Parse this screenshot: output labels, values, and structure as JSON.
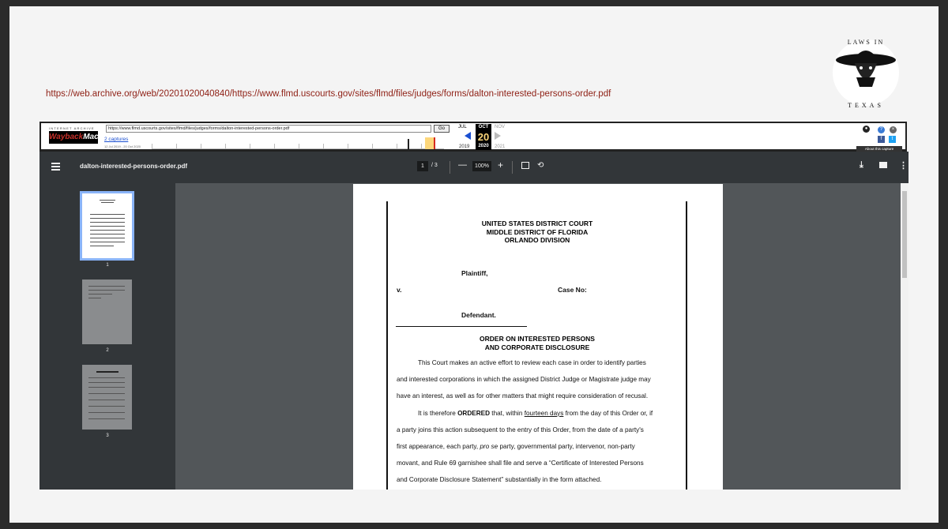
{
  "source_url": "https://web.archive.org/web/20201020040840/https://www.flmd.uscourts.gov/sites/flmd/files/judges/forms/dalton-interested-persons-order.pdf",
  "logo": {
    "text": "LAWS IN TEXAS"
  },
  "wayback": {
    "tagline": "INTERNET ARCHIVE",
    "logo_a": "Wayback",
    "logo_b": "Machine",
    "url": "https://www.flmd.uscourts.gov/sites/flmd/files/judges/forms/dalton-interested-persons-order.pdf",
    "go_label": "Go",
    "captures": "2 captures",
    "range": "12 Jul 2019 - 20 Oct 2020",
    "months": {
      "prev": "JUL",
      "current": "OCT",
      "next": "NOV"
    },
    "day": "20",
    "years": {
      "prev": "2019",
      "current": "2020",
      "next": "2021"
    },
    "about": "About this capture",
    "icons": [
      "user-icon",
      "help-icon",
      "close-icon",
      "facebook-icon",
      "twitter-icon"
    ]
  },
  "viewer": {
    "filename": "dalton-interested-persons-order.pdf",
    "page_current": "1",
    "page_total": "/ 3",
    "zoom": "100%",
    "thumbnails": [
      {
        "label": "1"
      },
      {
        "label": "2"
      },
      {
        "label": "3"
      }
    ]
  },
  "document": {
    "court_line1": "UNITED STATES DISTRICT COURT",
    "court_line2": "MIDDLE DISTRICT OF FLORIDA",
    "court_line3": "ORLANDO DIVISION",
    "plaintiff": "Plaintiff,",
    "versus": "v.",
    "case_no": "Case No:",
    "defendant": "Defendant.",
    "order_title_1": "ORDER ON INTERESTED PERSONS",
    "order_title_2": "AND CORPORATE DISCLOSURE",
    "para1_line1": "This Court makes an active effort to review each case in order to identify parties",
    "para1_line2": "and interested corporations in which the assigned District Judge or Magistrate judge may",
    "para1_line3": "have an interest, as well as for other matters that might require consideration of recusal.",
    "para2_a": "It is therefore ",
    "para2_bold": "ORDERED",
    "para2_b": " that, within ",
    "para2_under": "fourteen days",
    "para2_c": " from the day of this Order or, if",
    "para2_line2": "a party joins this action subsequent to the entry of this Order, from the date of a party's",
    "para2_line3_a": "first appearance, each party, ",
    "para2_line3_i": "pro se",
    "para2_line3_b": " party, governmental party, intervenor, non-party",
    "para2_line4": "movant, and Rule 69 garnishee shall file and serve a “Certificate of Interested Persons",
    "para2_line5": "and Corporate Disclosure Statement” substantially in the form attached."
  }
}
